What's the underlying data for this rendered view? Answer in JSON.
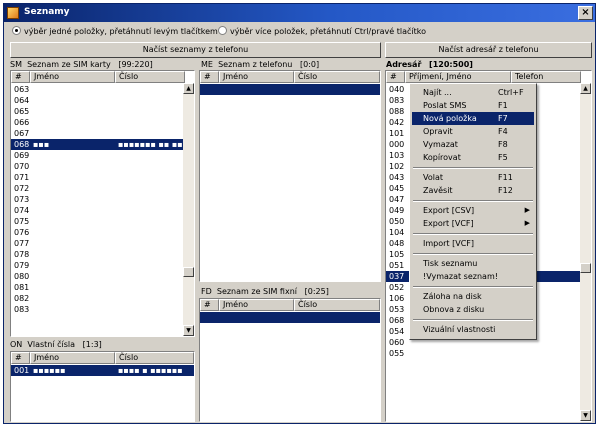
{
  "window": {
    "title": "Seznamy",
    "close_glyph": "×"
  },
  "options": {
    "single": "výběr jedné položky, přetáhnutí levým tlačítkem",
    "multi": "výběr více položek, přetáhnutí Ctrl/pravé tlačítko"
  },
  "buttons": {
    "load_lists": "Načíst seznamy z telefonu",
    "load_addressbook": "Načíst adresář z telefonu"
  },
  "sm": {
    "code": "SM",
    "label": "Seznam ze SIM karty",
    "count": "[99:220]",
    "headers": [
      "#",
      "Jméno",
      "Číslo"
    ],
    "rows": [
      "063",
      "064",
      "065",
      "066",
      "067",
      "068",
      "069",
      "070",
      "071",
      "072",
      "073",
      "074",
      "075",
      "076",
      "077",
      "078",
      "079",
      "080",
      "081",
      "082",
      "083"
    ],
    "selected_index": "068",
    "selected_name": "▪▪▪",
    "selected_number": "▪▪▪▪▪▪▪ ▪▪ ▪▪"
  },
  "me": {
    "code": "ME",
    "label": "Seznam z telefonu",
    "count": "[0:0]",
    "headers": [
      "#",
      "Jméno",
      "Číslo"
    ]
  },
  "fd": {
    "code": "FD",
    "label": "Seznam ze SIM fixní",
    "count": "[0:25]",
    "headers": [
      "#",
      "Jméno",
      "Číslo"
    ]
  },
  "on": {
    "code": "ON",
    "label": "Vlastní čísla",
    "count": "[1:3]",
    "headers": [
      "#",
      "Jméno",
      "Číslo"
    ],
    "row_index": "001",
    "row_name": "▪▪▪▪▪▪",
    "row_number": "▪▪▪▪ ▪ ▪▪▪▪▪▪"
  },
  "adr": {
    "label": "Adresář",
    "count": "[120:500]",
    "headers": [
      "#",
      "Příjmení, Jméno",
      "Telefon"
    ],
    "rows": [
      "040",
      "083",
      "088",
      "042",
      "101",
      "000",
      "103",
      "102",
      "043",
      "045",
      "047",
      "049",
      "050",
      "104",
      "048",
      "105",
      "051",
      "037",
      "052",
      "106",
      "053",
      "068",
      "054",
      "060",
      "055"
    ],
    "selected": "037"
  },
  "context_menu": {
    "items": [
      {
        "label": "Najít ...",
        "shortcut": "Ctrl+F"
      },
      {
        "label": "Poslat SMS",
        "shortcut": "F1"
      },
      {
        "label": "Nová položka",
        "shortcut": "F7"
      },
      {
        "label": "Opravit",
        "shortcut": "F4"
      },
      {
        "label": "Vymazat",
        "shortcut": "F8"
      },
      {
        "label": "Kopírovat",
        "shortcut": "F5"
      },
      {
        "label": "Volat",
        "shortcut": "F11"
      },
      {
        "label": "Zavěsit",
        "shortcut": "F12"
      },
      {
        "label": "Export [CSV]",
        "shortcut": ""
      },
      {
        "label": "Export [VCF]",
        "shortcut": ""
      },
      {
        "label": "Import [VCF]",
        "shortcut": ""
      },
      {
        "label": "Tisk seznamu",
        "shortcut": ""
      },
      {
        "label": "!Vymazat seznam!",
        "shortcut": ""
      },
      {
        "label": "Záloha na disk",
        "shortcut": ""
      },
      {
        "label": "Obnova z disku",
        "shortcut": ""
      },
      {
        "label": "Vizuální vlastnosti",
        "shortcut": ""
      }
    ],
    "submenu_arrow": "▶",
    "highlighted": "Nová položka"
  },
  "icons": {
    "scroll_up": "▲",
    "scroll_down": "▼"
  }
}
